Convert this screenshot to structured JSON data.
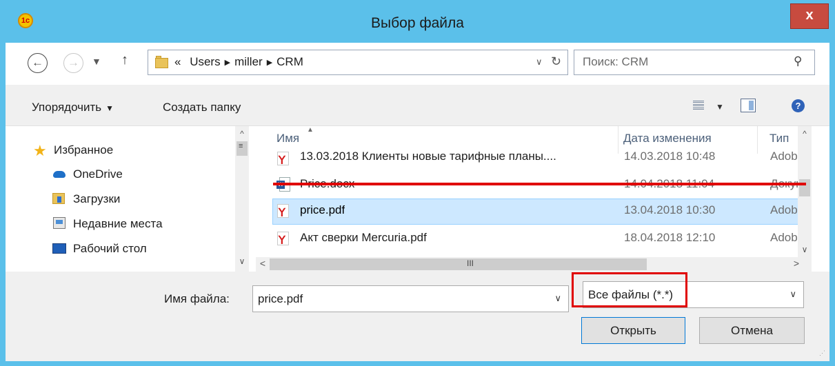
{
  "window": {
    "app_icon_text": "1с",
    "title": "Выбор файла",
    "close_label": "x"
  },
  "nav": {
    "back_icon": "arrow-left-icon",
    "forward_icon": "arrow-right-icon",
    "up_icon": "arrow-up-icon",
    "breadcrumb_prefix": "«",
    "breadcrumb": [
      "Users",
      "miller",
      "CRM"
    ],
    "search_placeholder": "Поиск: CRM"
  },
  "toolbar": {
    "organize_label": "Упорядочить",
    "new_folder_label": "Создать папку"
  },
  "sidebar": {
    "items": [
      {
        "label": "Избранное",
        "icon": "star-icon"
      },
      {
        "label": "OneDrive",
        "icon": "cloud-icon"
      },
      {
        "label": "Загрузки",
        "icon": "downloads-folder-icon"
      },
      {
        "label": "Недавние места",
        "icon": "recent-places-icon"
      },
      {
        "label": "Рабочий стол",
        "icon": "desktop-icon"
      }
    ]
  },
  "filelist": {
    "columns": [
      "Имя",
      "Дата изменения",
      "Тип"
    ],
    "rows": [
      {
        "name": "13.03.2018 Клиенты новые тарифные планы....",
        "date": "14.03.2018 10:48",
        "type": "Adobe",
        "icon": "pdf-icon",
        "selected": false
      },
      {
        "name": "Price.docx",
        "date": "14.04.2018 11:04",
        "type": "Докум",
        "icon": "word-doc-icon",
        "selected": false
      },
      {
        "name": "price.pdf",
        "date": "13.04.2018 10:30",
        "type": "Adobe",
        "icon": "pdf-icon",
        "selected": true
      },
      {
        "name": "Акт сверки Mercuria.pdf",
        "date": "18.04.2018 12:10",
        "type": "Adobe",
        "icon": "pdf-icon",
        "selected": false
      }
    ]
  },
  "bottom": {
    "filename_label": "Имя файла:",
    "filename_value": "price.pdf",
    "filter_value": "Все файлы (*.*)",
    "open_label": "Открыть",
    "cancel_label": "Отмена"
  },
  "colors": {
    "title_bar": "#5bc0ea",
    "close_button": "#c74b3f",
    "selection": "#cde8ff",
    "highlight_annotation": "#e00000"
  }
}
